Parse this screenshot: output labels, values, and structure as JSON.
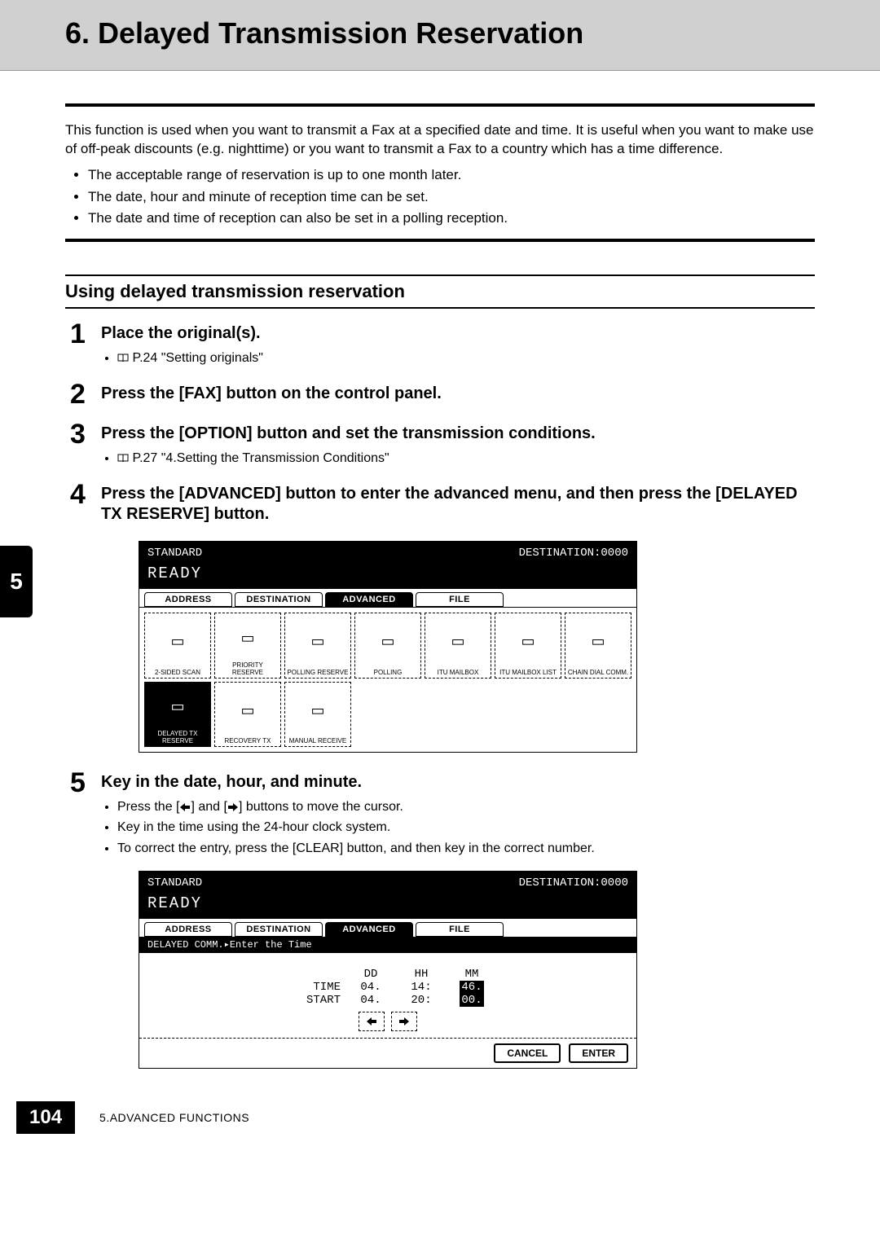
{
  "chapter_tab": "5",
  "header": {
    "title": "6. Delayed Transmission Reservation"
  },
  "intro": "This function is used when you want to transmit a Fax at a specified date and time. It is useful when you want to make use of off-peak discounts (e.g. nighttime) or you want to transmit a Fax to a country which has a time difference.",
  "intro_bullets": [
    "The acceptable range of reservation is up to one month later.",
    "The date, hour and minute of reception time can be set.",
    "The date and time of reception can also be set in a polling reception."
  ],
  "section_title": "Using delayed transmission reservation",
  "steps": {
    "s1": {
      "num": "1",
      "title": "Place the original(s).",
      "ref": "P.24 \"Setting originals\""
    },
    "s2": {
      "num": "2",
      "title": "Press the [FAX] button on the control panel."
    },
    "s3": {
      "num": "3",
      "title": "Press the [OPTION] button and set the transmission conditions.",
      "ref": "P.27 \"4.Setting the Transmission Conditions\""
    },
    "s4": {
      "num": "4",
      "title": "Press the [ADVANCED] button to enter the advanced menu, and then press the [DELAYED TX RESERVE] button."
    },
    "s5": {
      "num": "5",
      "title": "Key in the date, hour, and minute.",
      "subs": [
        "Press the [◀] and [▶] buttons to move the cursor.",
        "Key in the time using the 24-hour clock system.",
        "To correct the entry, press the [CLEAR] button, and then key in the correct number."
      ]
    }
  },
  "screen1": {
    "status_left": "STANDARD",
    "status_right": "DESTINATION:0000",
    "ready": "READY",
    "tabs": [
      "ADDRESS",
      "DESTINATION",
      "ADVANCED",
      "FILE"
    ],
    "active_tab": 2,
    "icons": [
      {
        "label": "2-SIDED SCAN"
      },
      {
        "label": "PRIORITY RESERVE"
      },
      {
        "label": "POLLING RESERVE"
      },
      {
        "label": "POLLING"
      },
      {
        "label": "ITU MAILBOX"
      },
      {
        "label": "ITU MAILBOX LIST"
      },
      {
        "label": "CHAIN DIAL COMM."
      },
      {
        "label": "DELAYED TX RESERVE",
        "selected": true
      },
      {
        "label": "RECOVERY TX"
      },
      {
        "label": "MANUAL RECEIVE"
      }
    ]
  },
  "screen2": {
    "status_left": "STANDARD",
    "status_right": "DESTINATION:0000",
    "ready": "READY",
    "tabs": [
      "ADDRESS",
      "DESTINATION",
      "ADVANCED",
      "FILE"
    ],
    "active_tab": 2,
    "msg": "DELAYED COMM.▸Enter the Time",
    "cols": [
      "",
      "DD",
      "HH",
      "MM"
    ],
    "time_label": "TIME",
    "start_label": "START",
    "time_row": [
      "04.",
      "14:",
      "46."
    ],
    "start_row": [
      "04.",
      "20:",
      "00."
    ],
    "hl_time": 2,
    "hl_start": 2,
    "cancel": "CANCEL",
    "enter": "ENTER"
  },
  "footer": {
    "page": "104",
    "label": "5.ADVANCED FUNCTIONS"
  }
}
